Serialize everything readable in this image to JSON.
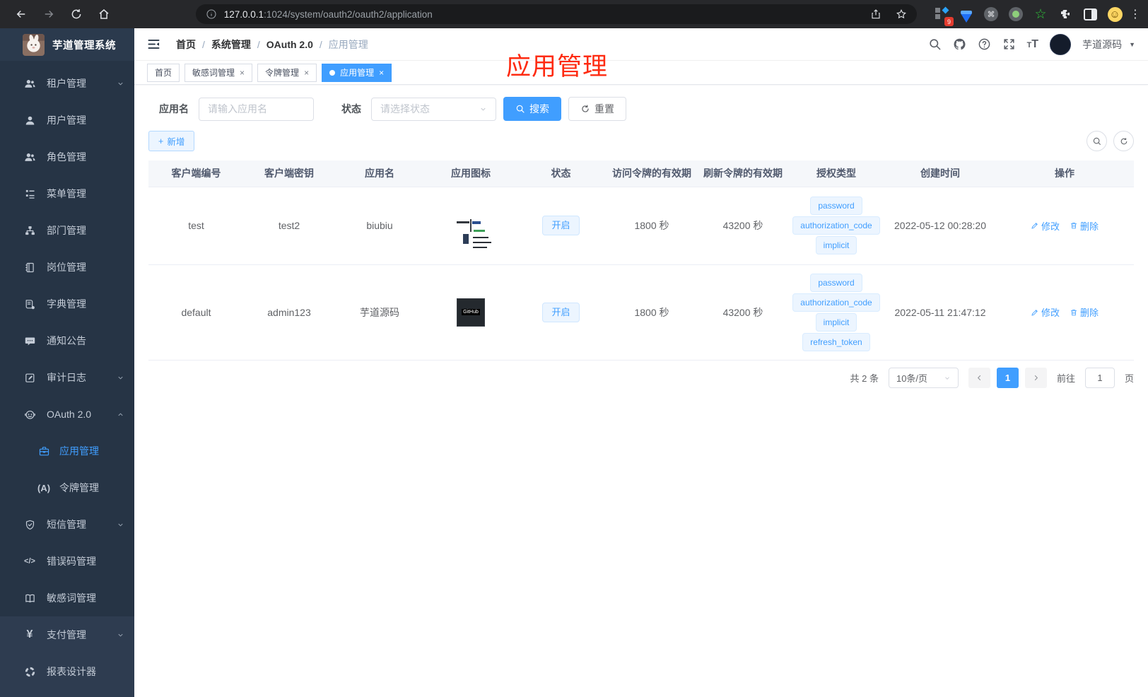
{
  "browser": {
    "url_host": "127.0.0.1",
    "url_rest": ":1024/system/oauth2/oauth2/application",
    "extension_badge": "9"
  },
  "sidebar": {
    "app_title": "芋道管理系统",
    "items": [
      {
        "label": "租户管理"
      },
      {
        "label": "用户管理"
      },
      {
        "label": "角色管理"
      },
      {
        "label": "菜单管理"
      },
      {
        "label": "部门管理"
      },
      {
        "label": "岗位管理"
      },
      {
        "label": "字典管理"
      },
      {
        "label": "通知公告"
      },
      {
        "label": "审计日志"
      },
      {
        "label": "OAuth 2.0"
      },
      {
        "label": "应用管理"
      },
      {
        "label": "令牌管理"
      },
      {
        "label": "短信管理"
      },
      {
        "label": "错误码管理"
      },
      {
        "label": "敏感词管理"
      },
      {
        "label": "支付管理"
      },
      {
        "label": "报表设计器"
      }
    ]
  },
  "header": {
    "breadcrumb": [
      "首页",
      "系统管理",
      "OAuth 2.0",
      "应用管理"
    ],
    "separator": "/",
    "user_name": "芋道源码"
  },
  "tabs": [
    {
      "label": "首页"
    },
    {
      "label": "敏感词管理"
    },
    {
      "label": "令牌管理"
    },
    {
      "label": "应用管理"
    }
  ],
  "annotation": "应用管理",
  "filters": {
    "name_label": "应用名",
    "name_placeholder": "请输入应用名",
    "status_label": "状态",
    "status_placeholder": "请选择状态",
    "search_label": "搜索",
    "reset_label": "重置",
    "add_label": "新增"
  },
  "table": {
    "columns": [
      "客户端编号",
      "客户端密钥",
      "应用名",
      "应用图标",
      "状态",
      "访问令牌的有效期",
      "刷新令牌的有效期",
      "授权类型",
      "创建时间",
      "操作"
    ],
    "rows": [
      {
        "client_id": "test",
        "secret": "test2",
        "name": "biubiu",
        "status": "开启",
        "access_validity": "1800 秒",
        "refresh_validity": "43200 秒",
        "grants": [
          "password",
          "authorization_code",
          "implicit"
        ],
        "created": "2022-05-12 00:28:20"
      },
      {
        "client_id": "default",
        "secret": "admin123",
        "name": "芋道源码",
        "icon_text": "GitHub",
        "status": "开启",
        "access_validity": "1800 秒",
        "refresh_validity": "43200 秒",
        "grants": [
          "password",
          "authorization_code",
          "implicit",
          "refresh_token"
        ],
        "created": "2022-05-11 21:47:12"
      }
    ],
    "edit_label": "修改",
    "delete_label": "删除"
  },
  "pagination": {
    "total": "共 2 条",
    "page_size": "10条/页",
    "current_page": "1",
    "goto_label": "前往",
    "goto_value": "1",
    "page_label": "页"
  },
  "ui": {
    "close_glyph": "×",
    "plus_glyph": "+",
    "caret_glyph": "▼",
    "yen_glyph": "¥",
    "code_glyph": "</>",
    "voice_glyph": "(A)",
    "star_glyph": "☆",
    "cmd_glyph": "⌘",
    "smiley_glyph": "☺",
    "dots_glyph": "⋮"
  },
  "colors": {
    "accent": "#409eff",
    "annotation_red": "#fe2b11",
    "sidebar_bg": "#263445",
    "tag_bg": "#ecf5ff",
    "tag_border": "#d9ecff"
  }
}
